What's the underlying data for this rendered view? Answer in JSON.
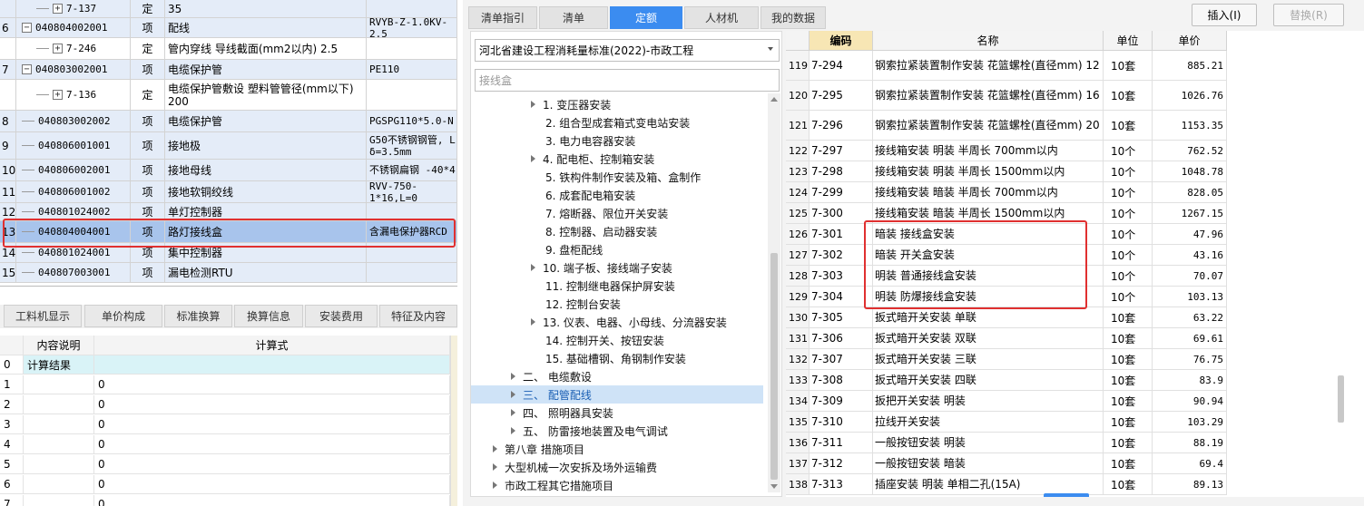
{
  "left_table": {
    "rows": [
      {
        "num": "",
        "code": "7-137",
        "type": "定",
        "name": "35",
        "spec": ""
      },
      {
        "num": "6",
        "code": "040804002001",
        "type": "项",
        "name": "配线",
        "spec": "RVYB-Z-1.0KV-2.5"
      },
      {
        "num": "",
        "code": "7-246",
        "type": "定",
        "name": "管内穿线 导线截面(mm2以内) 2.5",
        "spec": ""
      },
      {
        "num": "7",
        "code": "040803002001",
        "type": "项",
        "name": "电缆保护管",
        "spec": "PE110"
      },
      {
        "num": "",
        "code": "7-136",
        "type": "定",
        "name": "电缆保护管敷设 塑料管管径(mm以下) 200",
        "spec": ""
      },
      {
        "num": "8",
        "code": "040803002002",
        "type": "项",
        "name": "电缆保护管",
        "spec": "PGSPG110*5.0-N"
      },
      {
        "num": "9",
        "code": "040806001001",
        "type": "项",
        "name": "接地极",
        "spec": "G50不锈钢钢管, L δ=3.5mm"
      },
      {
        "num": "10",
        "code": "040806002001",
        "type": "项",
        "name": "接地母线",
        "spec": "不锈钢扁钢 -40*4"
      },
      {
        "num": "11",
        "code": "040806001002",
        "type": "项",
        "name": "接地软铜绞线",
        "spec": "RVV-750-1*16,L=0"
      },
      {
        "num": "12",
        "code": "040801024002",
        "type": "项",
        "name": "单灯控制器",
        "spec": ""
      },
      {
        "num": "13",
        "code": "040804004001",
        "type": "项",
        "name": "路灯接线盒",
        "spec": "含漏电保护器RCD"
      },
      {
        "num": "14",
        "code": "040801024001",
        "type": "项",
        "name": "集中控制器",
        "spec": ""
      },
      {
        "num": "15",
        "code": "040807003001",
        "type": "项",
        "name": "漏电检测RTU",
        "spec": ""
      }
    ]
  },
  "bottom_tabs": [
    "工料机显示",
    "单价构成",
    "标准换算",
    "换算信息",
    "安装费用",
    "特征及内容"
  ],
  "calc_table": {
    "headers": [
      "内容说明",
      "计算式"
    ],
    "rows": [
      {
        "num": "0",
        "desc": "计算结果",
        "formula": ""
      },
      {
        "num": "1",
        "desc": "",
        "formula": "0"
      },
      {
        "num": "2",
        "desc": "",
        "formula": "0"
      },
      {
        "num": "3",
        "desc": "",
        "formula": "0"
      },
      {
        "num": "4",
        "desc": "",
        "formula": "0"
      },
      {
        "num": "5",
        "desc": "",
        "formula": "0"
      },
      {
        "num": "6",
        "desc": "",
        "formula": "0"
      },
      {
        "num": "7",
        "desc": "",
        "formula": "0"
      }
    ]
  },
  "right_tabs": [
    "清单指引",
    "清单",
    "定额",
    "人材机",
    "我的数据"
  ],
  "active_tab": "定额",
  "insert_label": "插入(I)",
  "replace_label": "替换(R)",
  "standard_select": "河北省建设工程消耗量标准(2022)-市政工程",
  "search_value": "接线盒",
  "tree": [
    "1. 变压器安装",
    "2. 组合型成套箱式变电站安装",
    "3. 电力电容器安装",
    "4. 配电柜、控制箱安装",
    "5. 铁构件制作安装及箱、盒制作",
    "6. 成套配电箱安装",
    "7. 熔断器、限位开关安装",
    "8. 控制器、启动器安装",
    "9. 盘柜配线",
    "10. 端子板、接线端子安装",
    "11. 控制继电器保护屏安装",
    "12. 控制台安装",
    "13. 仪表、电器、小母线、分流器安装",
    "14. 控制开关、按钮安装",
    "15. 基础槽钢、角钢制作安装",
    "二、 电缆敷设",
    "三、 配管配线",
    "四、 照明器具安装",
    "五、 防雷接地装置及电气调试",
    "第八章 措施项目",
    "大型机械一次安拆及场外运输费",
    "市政工程其它措施项目"
  ],
  "grid": {
    "headers": [
      "编码",
      "名称",
      "单位",
      "单价"
    ],
    "rows": [
      {
        "n": "119",
        "code": "7-294",
        "name": "钢索拉紧装置制作安装 花篮螺栓(直径mm) 12",
        "unit": "10套",
        "price": "885.21"
      },
      {
        "n": "120",
        "code": "7-295",
        "name": "钢索拉紧装置制作安装 花篮螺栓(直径mm) 16",
        "unit": "10套",
        "price": "1026.76"
      },
      {
        "n": "121",
        "code": "7-296",
        "name": "钢索拉紧装置制作安装 花篮螺栓(直径mm) 20",
        "unit": "10套",
        "price": "1153.35"
      },
      {
        "n": "122",
        "code": "7-297",
        "name": "接线箱安装 明装 半周长 700mm以内",
        "unit": "10个",
        "price": "762.52"
      },
      {
        "n": "123",
        "code": "7-298",
        "name": "接线箱安装 明装 半周长 1500mm以内",
        "unit": "10个",
        "price": "1048.78"
      },
      {
        "n": "124",
        "code": "7-299",
        "name": "接线箱安装 暗装 半周长 700mm以内",
        "unit": "10个",
        "price": "828.05"
      },
      {
        "n": "125",
        "code": "7-300",
        "name": "接线箱安装 暗装 半周长 1500mm以内",
        "unit": "10个",
        "price": "1267.15"
      },
      {
        "n": "126",
        "code": "7-301",
        "name": "暗装 接线盒安装",
        "unit": "10个",
        "price": "47.96"
      },
      {
        "n": "127",
        "code": "7-302",
        "name": "暗装 开关盒安装",
        "unit": "10个",
        "price": "43.16"
      },
      {
        "n": "128",
        "code": "7-303",
        "name": "明装 普通接线盒安装",
        "unit": "10个",
        "price": "70.07"
      },
      {
        "n": "129",
        "code": "7-304",
        "name": "明装 防爆接线盒安装",
        "unit": "10个",
        "price": "103.13"
      },
      {
        "n": "130",
        "code": "7-305",
        "name": "扳式暗开关安装 单联",
        "unit": "10套",
        "price": "63.22"
      },
      {
        "n": "131",
        "code": "7-306",
        "name": "扳式暗开关安装 双联",
        "unit": "10套",
        "price": "69.61"
      },
      {
        "n": "132",
        "code": "7-307",
        "name": "扳式暗开关安装 三联",
        "unit": "10套",
        "price": "76.75"
      },
      {
        "n": "133",
        "code": "7-308",
        "name": "扳式暗开关安装 四联",
        "unit": "10套",
        "price": "83.9"
      },
      {
        "n": "134",
        "code": "7-309",
        "name": "扳把开关安装 明装",
        "unit": "10套",
        "price": "90.94"
      },
      {
        "n": "135",
        "code": "7-310",
        "name": "拉线开关安装",
        "unit": "10套",
        "price": "103.29"
      },
      {
        "n": "136",
        "code": "7-311",
        "name": "一般按钮安装 明装",
        "unit": "10套",
        "price": "88.19"
      },
      {
        "n": "137",
        "code": "7-312",
        "name": "一般按钮安装 暗装",
        "unit": "10套",
        "price": "69.4"
      },
      {
        "n": "138",
        "code": "7-313",
        "name": "插座安装 明装 单相二孔(15A)",
        "unit": "10套",
        "price": "89.13"
      }
    ]
  },
  "colors": {
    "accent": "#3b8cf0",
    "highlight_border": "#e03030",
    "selected_row": "#a8c4ec"
  }
}
